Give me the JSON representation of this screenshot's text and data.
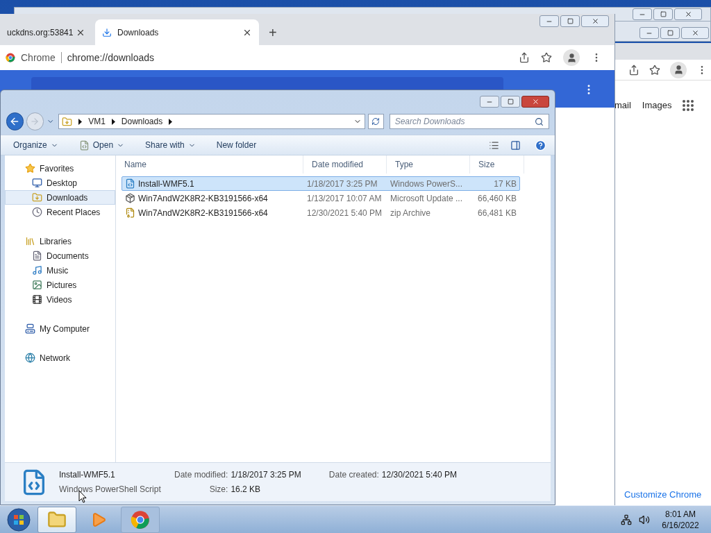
{
  "chrome_back": {
    "links": [
      "mail",
      "Images"
    ],
    "customize": "Customize Chrome"
  },
  "chrome": {
    "tabs": [
      {
        "title": "uckdns.org:53841",
        "selected": false
      },
      {
        "title": "Downloads",
        "selected": true
      }
    ],
    "new_tab": "+",
    "site_label": "Chrome",
    "url": "chrome://downloads"
  },
  "explorer": {
    "breadcrumb": [
      "VM1",
      "Downloads"
    ],
    "search_placeholder": "Search Downloads",
    "toolbar": [
      {
        "label": "Organize",
        "kind": "menu"
      },
      {
        "label": "Open",
        "kind": "menu-icon"
      },
      {
        "label": "Share with",
        "kind": "menu"
      },
      {
        "label": "New folder",
        "kind": "plain"
      }
    ],
    "nav": [
      {
        "label": "Favorites",
        "kind": "favorites",
        "selected": false,
        "children": [
          {
            "label": "Desktop",
            "kind": "desktop",
            "selected": false
          },
          {
            "label": "Downloads",
            "kind": "downloads",
            "selected": true
          },
          {
            "label": "Recent Places",
            "kind": "recent",
            "selected": false
          }
        ]
      },
      {
        "label": "Libraries",
        "kind": "libraries",
        "selected": false,
        "children": [
          {
            "label": "Documents",
            "kind": "documents",
            "selected": false
          },
          {
            "label": "Music",
            "kind": "music",
            "selected": false
          },
          {
            "label": "Pictures",
            "kind": "pictures",
            "selected": false
          },
          {
            "label": "Videos",
            "kind": "videos",
            "selected": false
          }
        ]
      },
      {
        "label": "My Computer",
        "kind": "computer",
        "selected": false
      },
      {
        "label": "Network",
        "kind": "network",
        "selected": false
      }
    ],
    "columns": [
      "Name",
      "Date modified",
      "Type",
      "Size"
    ],
    "rows": [
      {
        "name": "Install-WMF5.1",
        "date": "1/18/2017 3:25 PM",
        "type": "Windows PowerS...",
        "size": "17 KB",
        "kind": "script",
        "selected": true
      },
      {
        "name": "Win7AndW2K8R2-KB3191566-x64",
        "date": "1/13/2017 10:07 AM",
        "type": "Microsoft Update ...",
        "size": "66,460 KB",
        "kind": "update",
        "selected": false
      },
      {
        "name": "Win7AndW2K8R2-KB3191566-x64",
        "date": "12/30/2021 5:40 PM",
        "type": "zip Archive",
        "size": "66,481 KB",
        "kind": "zip",
        "selected": false
      }
    ],
    "details": {
      "name": "Install-WMF5.1",
      "type": "Windows PowerShell Script",
      "fields": [
        {
          "label": "Date modified:",
          "value": "1/18/2017 3:25 PM"
        },
        {
          "label": "Size:",
          "value": "16.2 KB"
        },
        {
          "label": "Date created:",
          "value": "12/30/2021 5:40 PM"
        }
      ]
    }
  },
  "taskbar": {
    "items": [
      {
        "kind": "explorer",
        "selected": true
      },
      {
        "kind": "media",
        "selected": false
      },
      {
        "kind": "chrome",
        "selected": false
      }
    ],
    "time": "8:01 AM",
    "date": "6/16/2022"
  }
}
